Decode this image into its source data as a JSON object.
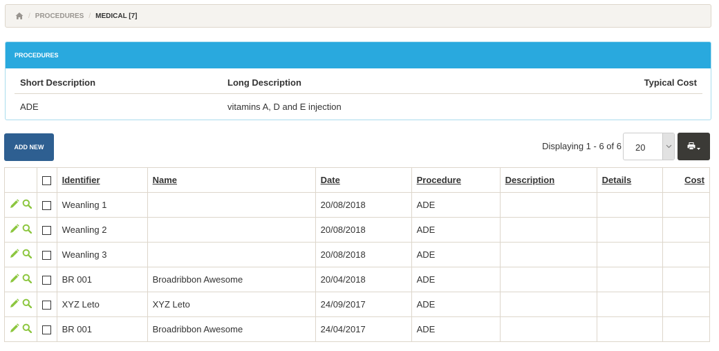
{
  "breadcrumb": {
    "home_icon": "home-icon",
    "items": [
      {
        "label": "PROCEDURES",
        "active": false
      },
      {
        "label": "MEDICAL [7]",
        "active": true
      }
    ],
    "separator": "/"
  },
  "procedures_panel": {
    "title": "PROCEDURES",
    "columns": [
      "Short Description",
      "Long Description",
      "Typical Cost"
    ],
    "rows": [
      {
        "short": "ADE",
        "long": "vitamins A, D and E injection",
        "cost": ""
      }
    ]
  },
  "toolbar": {
    "add_new_label": "ADD NEW",
    "displaying_text": "Displaying 1 - 6 of 6",
    "page_size": "20",
    "print_icon": "print-icon"
  },
  "grid": {
    "columns": [
      "Identifier",
      "Name",
      "Date",
      "Procedure",
      "Description",
      "Details",
      "Cost"
    ],
    "colors": {
      "action_icon": "#8cc63f"
    },
    "rows": [
      {
        "identifier": "Weanling 1",
        "name": "",
        "date": "20/08/2018",
        "procedure": "ADE",
        "description": "",
        "details": "",
        "cost": ""
      },
      {
        "identifier": "Weanling 2",
        "name": "",
        "date": "20/08/2018",
        "procedure": "ADE",
        "description": "",
        "details": "",
        "cost": ""
      },
      {
        "identifier": "Weanling 3",
        "name": "",
        "date": "20/08/2018",
        "procedure": "ADE",
        "description": "",
        "details": "",
        "cost": ""
      },
      {
        "identifier": "BR 001",
        "name": "Broadribbon Awesome",
        "date": "20/04/2018",
        "procedure": "ADE",
        "description": "",
        "details": "",
        "cost": ""
      },
      {
        "identifier": "XYZ Leto",
        "name": "XYZ Leto",
        "date": "24/09/2017",
        "procedure": "ADE",
        "description": "",
        "details": "",
        "cost": ""
      },
      {
        "identifier": "BR 001",
        "name": "Broadribbon Awesome",
        "date": "24/04/2017",
        "procedure": "ADE",
        "description": "",
        "details": "",
        "cost": ""
      }
    ]
  }
}
